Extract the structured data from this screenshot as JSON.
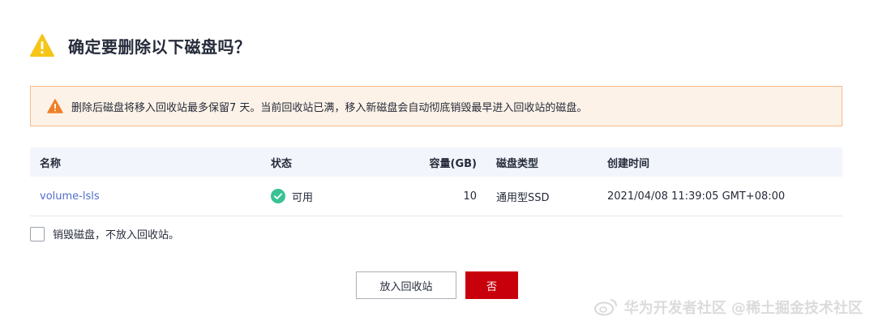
{
  "dialog": {
    "title": "确定要删除以下磁盘吗？",
    "alert_text": "删除后磁盘将移入回收站最多保留7 天。当前回收站已满，移入新磁盘会自动彻底销毁最早进入回收站的磁盘。"
  },
  "table": {
    "headers": {
      "name": "名称",
      "status": "状态",
      "size": "容量(GB)",
      "type": "磁盘类型",
      "created": "创建时间"
    },
    "rows": [
      {
        "name": "volume-lsls",
        "status": "可用",
        "size": "10",
        "type": "通用型SSD",
        "created": "2021/04/08 11:39:05 GMT+08:00"
      }
    ]
  },
  "checkbox": {
    "label": "销毁磁盘，不放入回收站。",
    "checked": false
  },
  "buttons": {
    "recycle": "放入回收站",
    "no": "否"
  },
  "watermark": {
    "text": "华为开发者社区  @稀土掘金技术社区"
  },
  "colors": {
    "warning": "#f5a623",
    "alert_bg": "#fdf2e7",
    "alert_border": "#f5b98a",
    "primary_button": "#c7000b",
    "link": "#526ecc",
    "status_ok": "#3ac295",
    "table_header_bg": "#f2f5fc"
  }
}
